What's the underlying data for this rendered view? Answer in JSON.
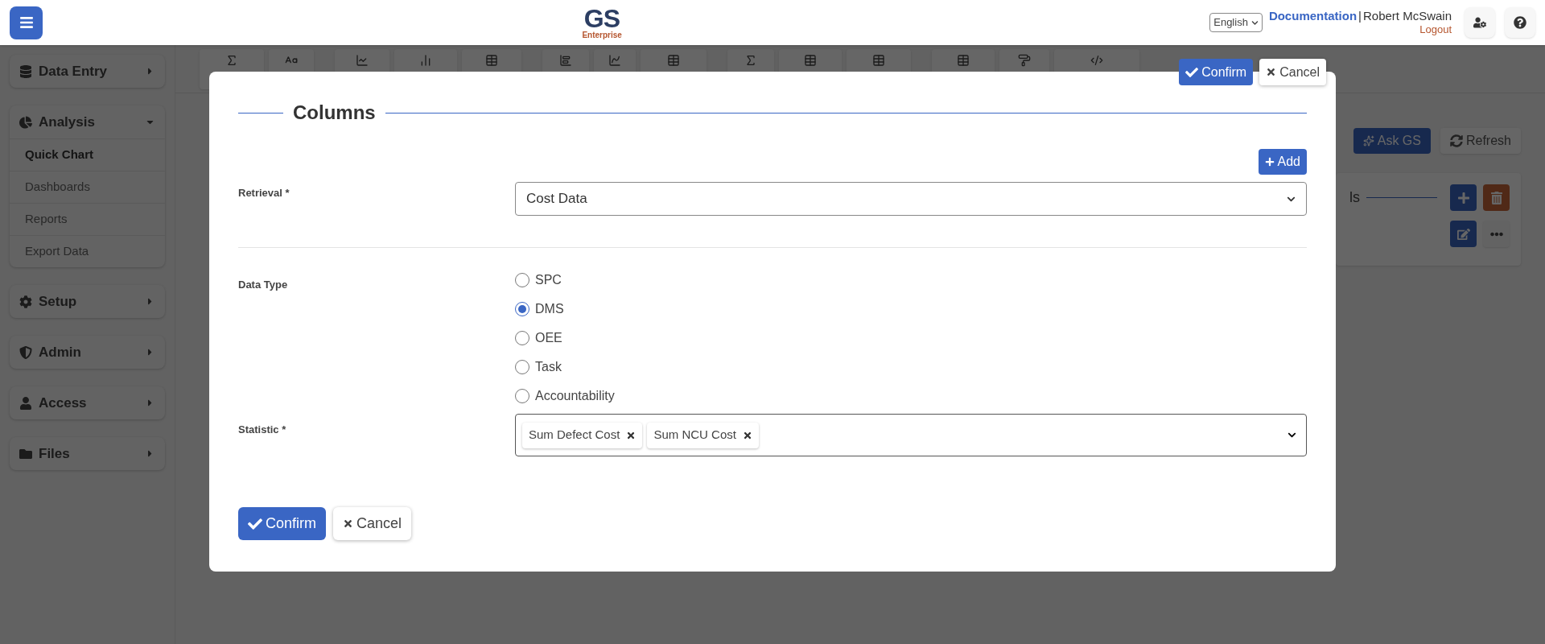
{
  "header": {
    "logo": {
      "title": "GS",
      "subtitle": "Enterprise"
    },
    "language": "English",
    "documentation": "Documentation",
    "separator": "|",
    "user": "Robert McSwain",
    "logout": "Logout"
  },
  "sidebar": [
    {
      "label": "Data Entry",
      "kind": "database",
      "expanded": false
    },
    {
      "label": "Analysis",
      "kind": "chart",
      "expanded": true,
      "children": [
        {
          "label": "Quick Chart",
          "selected": true
        },
        {
          "label": "Dashboards",
          "selected": false
        },
        {
          "label": "Reports",
          "selected": false
        },
        {
          "label": "Export Data",
          "selected": false
        }
      ]
    },
    {
      "label": "Setup",
      "kind": "gear",
      "expanded": false
    },
    {
      "label": "Admin",
      "kind": "shield",
      "expanded": false
    },
    {
      "label": "Access",
      "kind": "user",
      "expanded": false
    },
    {
      "label": "Files",
      "kind": "folder",
      "expanded": false
    }
  ],
  "page": {
    "ask_button": "Ask GS",
    "refresh_button": "Refresh",
    "card_title": "ls"
  },
  "modal": {
    "top_confirm": "Confirm",
    "top_cancel": "Cancel",
    "title": "Columns",
    "add_button": "Add",
    "retrieval": {
      "label": "Retrieval *",
      "value": "Cost Data"
    },
    "data_type": {
      "label": "Data Type",
      "options": [
        {
          "label": "SPC",
          "selected": false
        },
        {
          "label": "DMS",
          "selected": true
        },
        {
          "label": "OEE",
          "selected": false
        },
        {
          "label": "Task",
          "selected": false
        },
        {
          "label": "Accountability",
          "selected": false
        }
      ]
    },
    "statistic": {
      "label": "Statistic *",
      "tags": [
        "Sum Defect Cost",
        "Sum NCU Cost"
      ]
    },
    "confirm": "Confirm",
    "cancel": "Cancel"
  }
}
